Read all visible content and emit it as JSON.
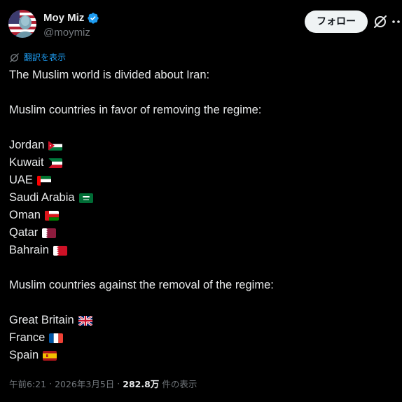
{
  "author": {
    "display_name": "Moy Miz",
    "handle": "@moymiz"
  },
  "header": {
    "follow_label": "フォロー"
  },
  "translate": {
    "label": "翻訳を表示"
  },
  "post": {
    "intro": "The Muslim world is divided about Iran:",
    "in_favor_heading": "Muslim countries in favor of removing the regime:",
    "in_favor": [
      {
        "country": "Jordan",
        "flag": "jordan-flag"
      },
      {
        "country": "Kuwait",
        "flag": "kuwait-flag"
      },
      {
        "country": "UAE",
        "flag": "uae-flag"
      },
      {
        "country": "Saudi Arabia",
        "flag": "saudi-arabia-flag"
      },
      {
        "country": "Oman",
        "flag": "oman-flag"
      },
      {
        "country": "Qatar",
        "flag": "qatar-flag"
      },
      {
        "country": "Bahrain",
        "flag": "bahrain-flag"
      }
    ],
    "against_heading": "Muslim countries against the removal of the regime:",
    "against": [
      {
        "country": "Great Britain",
        "flag": "united-kingdom-flag"
      },
      {
        "country": "France",
        "flag": "france-flag"
      },
      {
        "country": "Spain",
        "flag": "spain-flag"
      }
    ]
  },
  "meta": {
    "time": "午前6:21",
    "separator": "·",
    "date": "2026年3月5日",
    "views_count": "282.8万",
    "views_label": "件の表示"
  },
  "colors": {
    "background": "#000000",
    "text": "#e7e9ea",
    "secondary_text": "#71767b",
    "accent": "#1d9bf0",
    "follow_button_bg": "#eff3f4"
  }
}
